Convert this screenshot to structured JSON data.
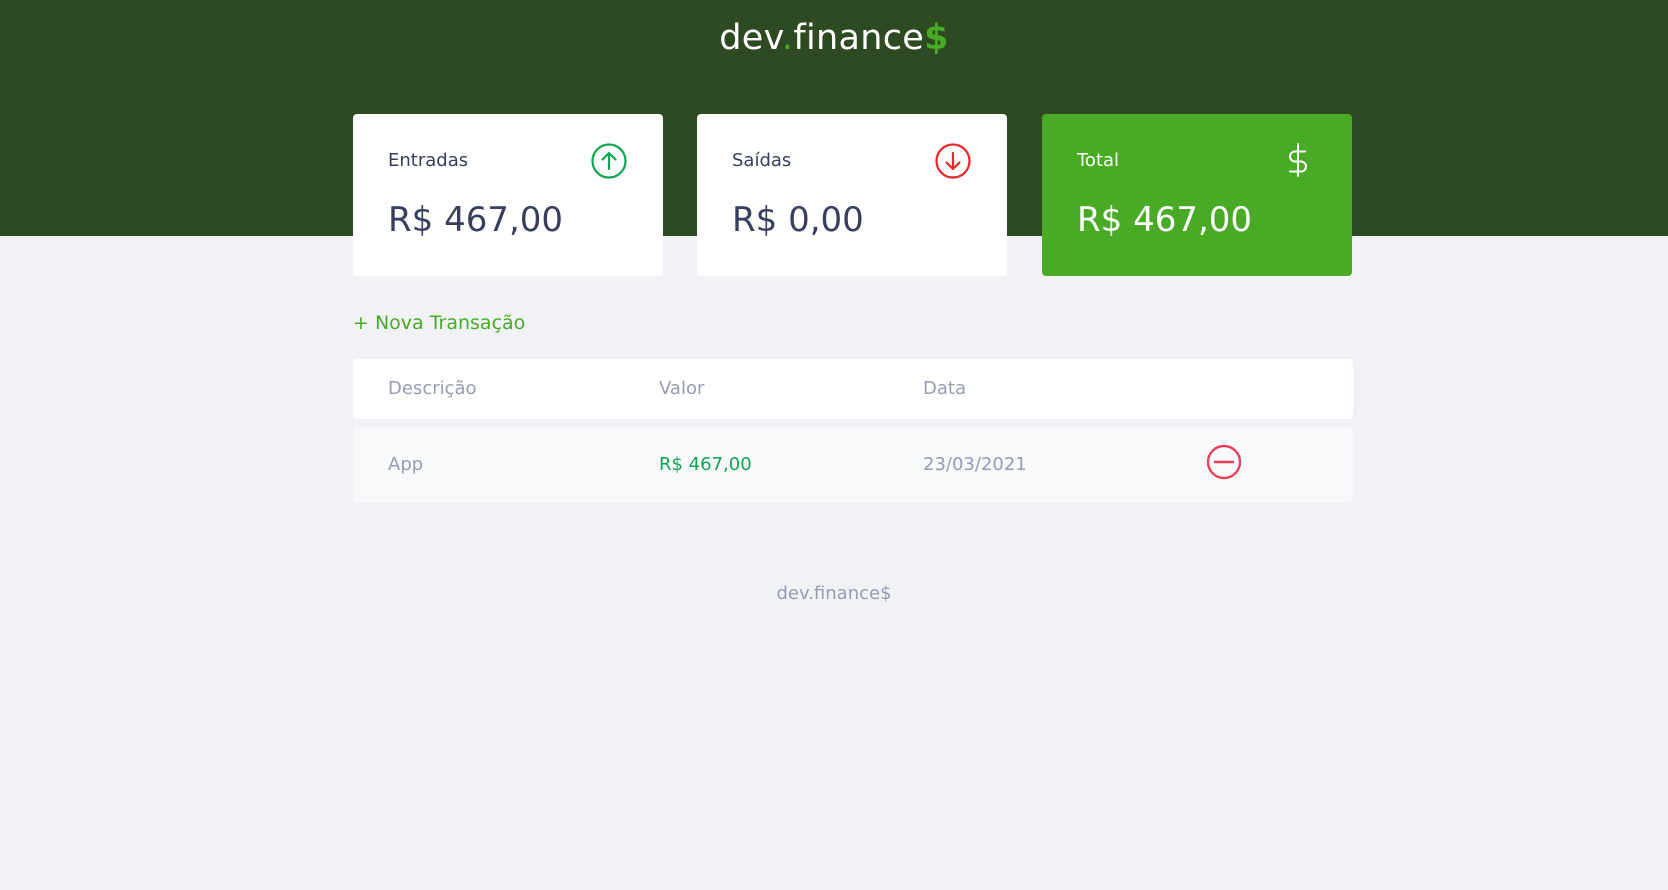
{
  "logo": {
    "part1": "dev",
    "dot": ".",
    "part2": "finance",
    "dollar": "$"
  },
  "cards": {
    "income": {
      "label": "Entradas",
      "value": "R$ 467,00",
      "icon": "arrow-up-circle-icon",
      "color": "#12a454"
    },
    "expense": {
      "label": "Saídas",
      "value": "R$ 0,00",
      "icon": "arrow-down-circle-icon",
      "color": "#e92929"
    },
    "total": {
      "label": "Total",
      "value": "R$ 467,00",
      "icon": "dollar-icon",
      "color": "#49aa26"
    }
  },
  "new_transaction_label": "+ Nova Transação",
  "table": {
    "headers": [
      "Descrição",
      "Valor",
      "Data"
    ],
    "rows": [
      {
        "description": "App",
        "amount": "R$ 467,00",
        "date": "23/03/2021",
        "action_icon": "minus-circle-icon"
      }
    ]
  },
  "footer": "dev.finance$",
  "colors": {
    "header_bg": "#2d4a22",
    "accent": "#49aa26",
    "page_bg": "#f0f2f5",
    "income": "#12a454",
    "expense": "#e92929"
  }
}
